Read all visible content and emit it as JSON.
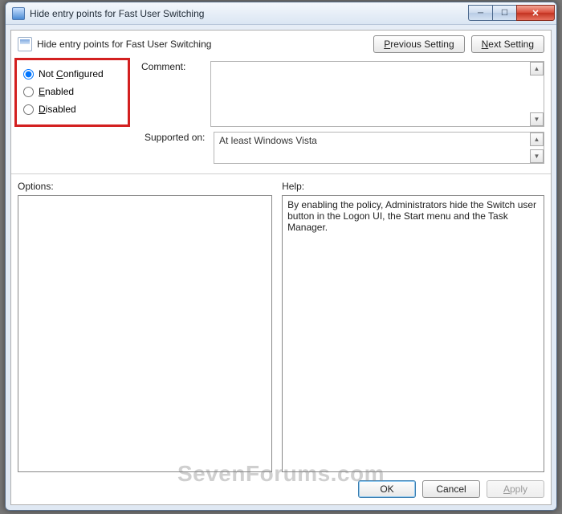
{
  "window": {
    "title": "Hide entry points for Fast User Switching"
  },
  "header": {
    "title": "Hide entry points for Fast User Switching"
  },
  "nav": {
    "prev": "Previous Setting",
    "next": "Next Setting",
    "prev_mn": "P",
    "next_mn": "N"
  },
  "state": {
    "options": [
      {
        "label_pre": "Not ",
        "mn": "C",
        "label_post": "onfigured",
        "checked": true
      },
      {
        "label_pre": "",
        "mn": "E",
        "label_post": "nabled",
        "checked": false
      },
      {
        "label_pre": "",
        "mn": "D",
        "label_post": "isabled",
        "checked": false
      }
    ]
  },
  "labels": {
    "comment": "Comment:",
    "supported": "Supported on:",
    "options": "Options:",
    "help": "Help:"
  },
  "supported": {
    "value": "At least Windows Vista"
  },
  "comment": {
    "value": ""
  },
  "help": {
    "text": "By enabling the policy, Administrators hide the Switch user button in the Logon UI, the Start menu and the Task Manager."
  },
  "buttons": {
    "ok": "OK",
    "cancel": "Cancel",
    "apply": "Apply",
    "apply_mn": "A"
  },
  "watermark": "SevenForums.com"
}
